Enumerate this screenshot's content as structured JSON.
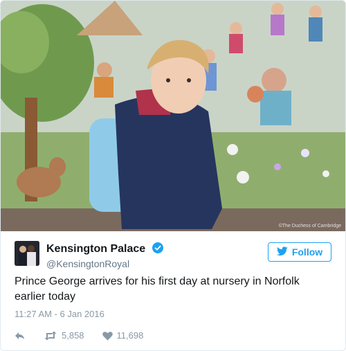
{
  "photo": {
    "credit": "©The Duchess of Cambridge"
  },
  "tweet": {
    "display_name": "Kensington Palace",
    "handle": "@KensingtonRoyal",
    "follow_label": "Follow",
    "text": "Prince George arrives for his first day at nursery in Norfolk earlier today",
    "timestamp": "11:27 AM - 6 Jan 2016",
    "retweet_count": "5,858",
    "like_count": "11,698"
  },
  "colors": {
    "brand_blue": "#1da1f2",
    "verified_blue": "#1da1f2",
    "muted_text": "#8899a6",
    "primary_text": "#14171a"
  },
  "icons": {
    "verified": "verified-badge-icon",
    "follow": "twitter-bird-icon",
    "reply": "reply-icon",
    "retweet": "retweet-icon",
    "like": "heart-icon"
  }
}
